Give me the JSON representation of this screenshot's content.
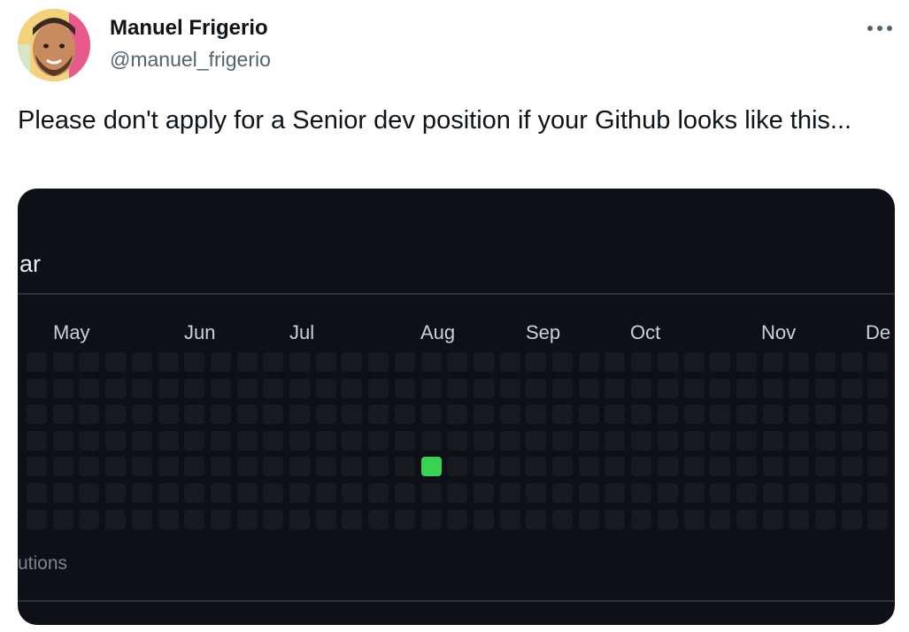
{
  "author": {
    "name": "Manuel Frigerio",
    "handle": "@manuel_frigerio"
  },
  "tweet": {
    "text": "Please don't apply for a Senior dev position if your Github looks like this..."
  },
  "media": {
    "year_fragment": "ar",
    "contributions_fragment": "utions",
    "months": [
      "May",
      "Jun",
      "Jul",
      "Aug",
      "Sep",
      "Oct",
      "Nov",
      "De"
    ],
    "empty_cell_color": "#161b22",
    "active_cell_color": "#39d353",
    "active_contributions": [
      {
        "week": 15,
        "day": 4,
        "level": 4
      }
    ]
  },
  "icons": {
    "more": "more-horizontal-icon",
    "avatar": "avatar-photo"
  }
}
